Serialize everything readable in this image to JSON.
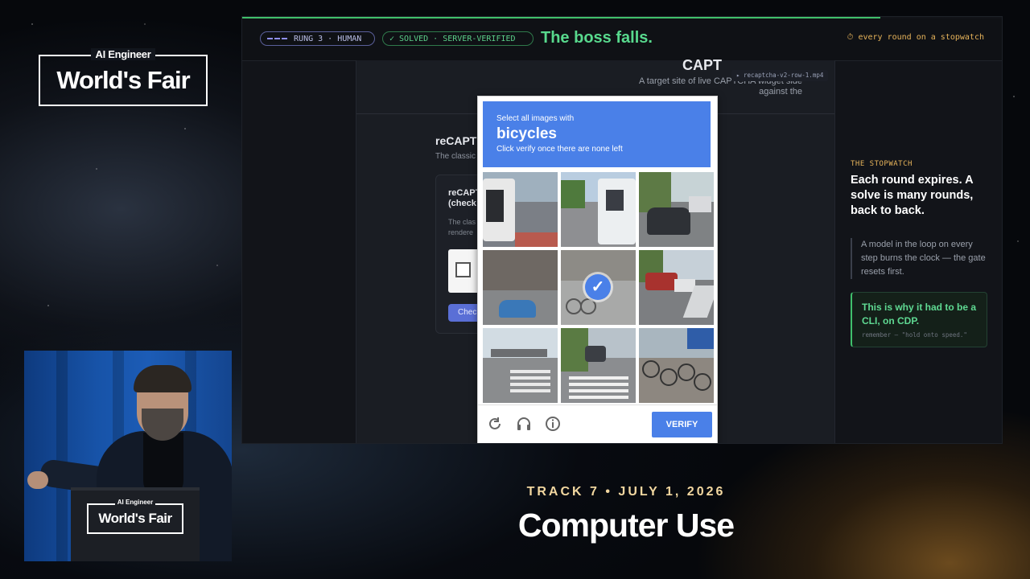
{
  "event": {
    "logo_small": "AI Engineer",
    "logo_main": "World's Fair",
    "track": "TRACK 7 • JULY 1, 2026",
    "title": "Computer Use"
  },
  "slide": {
    "badge_rung": "RUNG 3 · HUMAN",
    "badge_solved": "✓ SOLVED · SERVER-VERIFIED",
    "headline": "The boss falls.",
    "stopwatch": "⏱ every round on a stopwatch",
    "video_tag": "▸ recaptcha-v2-row-1.mp4",
    "progress_fraction": 0.84
  },
  "target_page": {
    "title": "CAPT",
    "subtitle": "A target site of live CAPTCHA widget side against the",
    "section_title": "reCAPT",
    "section_desc": "The classic",
    "card_title_1": "reCAPT",
    "card_title_2": "(check",
    "card_desc_1": "The clas",
    "card_desc_2": "rendere",
    "card_button": "Chec"
  },
  "captcha": {
    "line1": "Select all images with",
    "target": "bicycles",
    "line3": "Click verify once there are none left",
    "selected_tiles": [
      4
    ],
    "verify_label": "VERIFY",
    "icons": [
      "reload-icon",
      "audio-icon",
      "info-icon"
    ],
    "colors": {
      "header": "#4a80e8",
      "verify": "#4a80e8"
    }
  },
  "sidebar": {
    "label": "THE STOPWATCH",
    "heading": "Each round expires. A solve is many rounds, back to back.",
    "quote": "A model in the loop on every step burns the clock — the gate resets first.",
    "callout": "This is why it had to be a CLI, on CDP.",
    "callout_note": "remember — \"hold onto speed.\""
  },
  "podium": {
    "logo_small": "AI Engineer",
    "logo_main": "World's Fair"
  }
}
